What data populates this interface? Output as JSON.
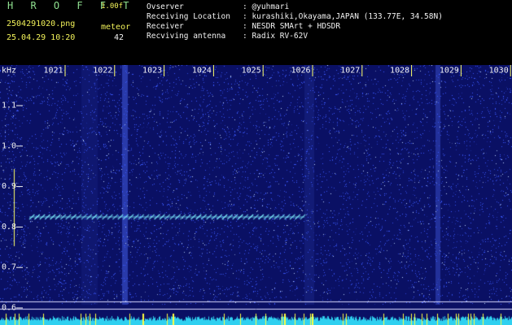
{
  "header": {
    "app_name": "H R O F F T",
    "version": "1.00f",
    "filename": "2504291020.png",
    "mode": "meteor",
    "datetime": "25.04.29 10:20",
    "count": "42",
    "info": [
      {
        "label": "Ovserver",
        "value": ": @yuhmari"
      },
      {
        "label": "Receiving Location",
        "value": ": kurashiki,Okayama,JAPAN (133.77E, 34.58N)"
      },
      {
        "label": "Receiver",
        "value": ": NESDR SMArt + HDSDR"
      },
      {
        "label": "Recviving antenna",
        "value": ": Radix RV-62V"
      }
    ]
  },
  "spectrogram": {
    "freq_unit": "kHz",
    "time_labels": [
      "1021",
      "1022",
      "1023",
      "1024",
      "1025",
      "1026",
      "1027",
      "1028",
      "1029",
      "1030"
    ],
    "freq_labels": [
      "1.1",
      "1.0",
      "0.9",
      "0.8",
      "0.7",
      "0.6"
    ],
    "colors": {
      "background": "#0a1064",
      "noise": "#3c5aff",
      "signal": "#7ff0ff",
      "ticks": "#ffff66",
      "panel_text": "#f2f2f2"
    }
  }
}
